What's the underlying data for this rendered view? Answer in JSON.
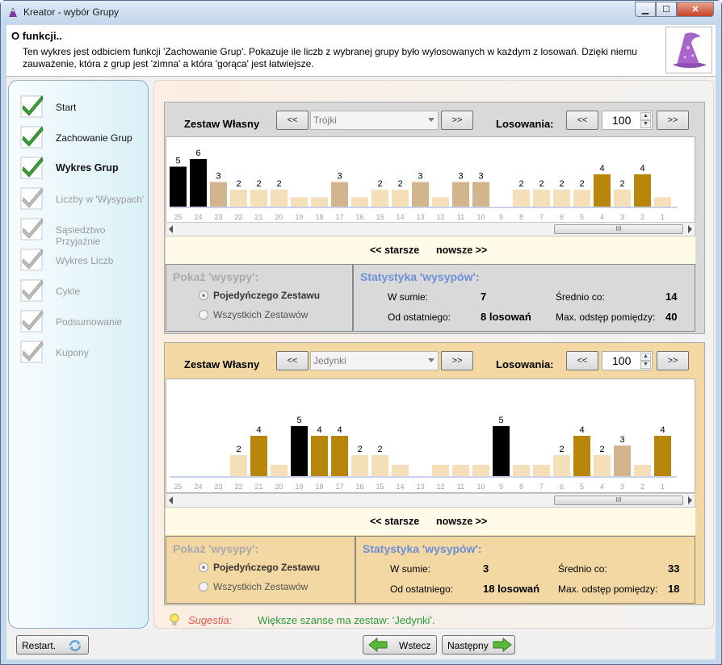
{
  "window": {
    "title": "Kreator - wybór Grupy",
    "min_label": "▁",
    "max_label": "☐",
    "close_label": "✕"
  },
  "info": {
    "title": "O funkcji..",
    "text": "Ten wykres jest odbiciem funkcji 'Zachowanie Grup'. Pokazuje ile liczb z wybranej grupy było wylosowanych w każdym z losowań. Dzięki niemu zauważenie, która z grup jest 'zimna' a która 'gorąca' jest łatwiejsze."
  },
  "steps": [
    {
      "label": "Start",
      "state": "done"
    },
    {
      "label": "Zachowanie Grup",
      "state": "done"
    },
    {
      "label": "Wykres Grup",
      "state": "current"
    },
    {
      "label": "Liczby w 'Wysypach'",
      "state": "disabled"
    },
    {
      "label": "Sąsiedztwo Przyjaźnie",
      "state": "disabled"
    },
    {
      "label": "Wykres Liczb",
      "state": "disabled"
    },
    {
      "label": "Cykle",
      "state": "disabled"
    },
    {
      "label": "Podsumowanie",
      "state": "disabled"
    },
    {
      "label": "Kupony",
      "state": "disabled"
    }
  ],
  "panels": [
    {
      "set_label": "Zestaw Własny",
      "prev_label": "<<",
      "next_label": ">>",
      "group": "Trójki",
      "draws_label": "Losowania:",
      "draws_prev": "<<",
      "draws_next": ">>",
      "draws_value": "100",
      "older": "<< starsze",
      "newer": "nowsze >>",
      "islands": {
        "title": "Pokaż 'wysypy':",
        "option1": "Pojedyńczego Zestawu",
        "option2": "Wszystkich Zestawów"
      },
      "stats": {
        "title": "Statystyka 'wysypów':",
        "total_label": "W sumie:",
        "total": "7",
        "avg_label": "Średnio co:",
        "avg": "14",
        "since_label": "Od ostatniego:",
        "since": "8 losowań",
        "maxgap_label": "Max. odstęp pomiędzy:",
        "maxgap": "40"
      }
    },
    {
      "set_label": "Zestaw Własny",
      "prev_label": "<<",
      "next_label": ">>",
      "group": "Jedynki",
      "draws_label": "Losowania:",
      "draws_prev": "<<",
      "draws_next": ">>",
      "draws_value": "100",
      "older": "<< starsze",
      "newer": "nowsze >>",
      "islands": {
        "title": "Pokaż 'wysypy':",
        "option1": "Pojedyńczego Zestawu",
        "option2": "Wszystkich Zestawów"
      },
      "stats": {
        "title": "Statystyka 'wysypów':",
        "total_label": "W sumie:",
        "total": "3",
        "avg_label": "Średnio co:",
        "avg": "33",
        "since_label": "Od ostatniego:",
        "since": "18 losowań",
        "maxgap_label": "Max. odstęp pomiędzy:",
        "maxgap": "18"
      }
    }
  ],
  "chart_data": [
    {
      "type": "bar",
      "categories": [
        "25",
        "24",
        "23",
        "22",
        "21",
        "20",
        "19",
        "18",
        "17",
        "16",
        "15",
        "14",
        "13",
        "12",
        "11",
        "10",
        "9",
        "8",
        "7",
        "6",
        "5",
        "4",
        "3",
        "2",
        "1"
      ],
      "values": [
        5,
        6,
        3,
        2,
        2,
        2,
        1,
        1,
        3,
        1,
        2,
        2,
        3,
        1,
        3,
        3,
        0,
        2,
        2,
        2,
        2,
        4,
        2,
        4,
        1
      ],
      "value_labels": [
        "5",
        "6",
        "3",
        "2",
        "2",
        "2",
        "",
        "",
        "3",
        "",
        "2",
        "2",
        "3",
        "",
        "3",
        "3",
        "",
        "2",
        "2",
        "2",
        "2",
        "4",
        "2",
        "4",
        ""
      ],
      "ylim": [
        0,
        6
      ],
      "colors": {
        "1": "#f5dfb8",
        "2": "#f5dfb8",
        "3": "#d2b58c",
        "4": "#b8860b",
        "5": "#000000",
        "6": "#000000"
      }
    },
    {
      "type": "bar",
      "categories": [
        "25",
        "24",
        "23",
        "22",
        "21",
        "20",
        "19",
        "18",
        "17",
        "16",
        "15",
        "14",
        "13",
        "12",
        "11",
        "10",
        "9",
        "8",
        "7",
        "6",
        "5",
        "4",
        "3",
        "2",
        "1"
      ],
      "values": [
        0,
        0,
        0,
        2,
        4,
        1,
        5,
        4,
        4,
        2,
        2,
        1,
        0,
        1,
        1,
        1,
        5,
        1,
        1,
        2,
        4,
        2,
        3,
        1,
        4
      ],
      "value_labels": [
        "",
        "",
        "",
        "2",
        "4",
        "",
        "5",
        "4",
        "4",
        "2",
        "2",
        "",
        "",
        "",
        "",
        "",
        "5",
        "",
        "",
        "2",
        "4",
        "2",
        "3",
        "",
        "4"
      ],
      "ylim": [
        0,
        6
      ],
      "colors": {
        "1": "#f5dfb8",
        "2": "#f5dfb8",
        "3": "#d2b58c",
        "4": "#b8860b",
        "5": "#000000",
        "6": "#000000"
      }
    }
  ],
  "suggestion": {
    "label": "Sugestia:",
    "text": "Większe szanse ma zestaw: 'Jedynki'."
  },
  "footer": {
    "restart": "Restart.",
    "back": "Wstecz",
    "next": "Następny"
  }
}
